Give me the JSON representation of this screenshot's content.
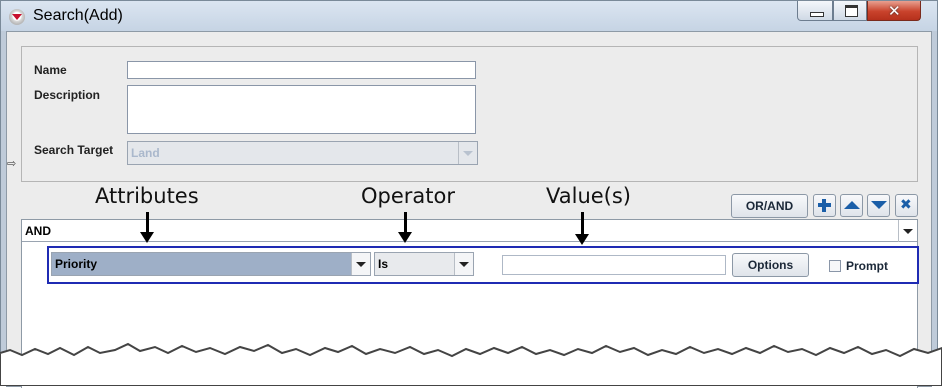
{
  "window": {
    "title": "Search(Add)"
  },
  "details": {
    "name_label": "Name",
    "name_value": "",
    "description_label": "Description",
    "description_value": "",
    "search_target_label": "Search Target",
    "search_target_value": "Land"
  },
  "toolbar": {
    "or_and_label": "OR/AND",
    "icons": [
      "plus-icon",
      "up-arrow-icon",
      "down-arrow-icon",
      "delete-x-icon"
    ]
  },
  "criteria": {
    "group_operator": "AND",
    "row": {
      "attribute": "Priority",
      "operator": "Is",
      "value": "",
      "options_label": "Options",
      "prompt_label": "Prompt",
      "prompt_checked": false
    }
  },
  "annotations": {
    "attributes": "Attributes",
    "operator": "Operator",
    "values": "Value(s)"
  },
  "colors": {
    "criterion_border": "#1f2bb3",
    "attribute_selected_bg": "#9eafc7",
    "icon_blue": "#1a5ea8",
    "close_button": "#c9432c"
  }
}
